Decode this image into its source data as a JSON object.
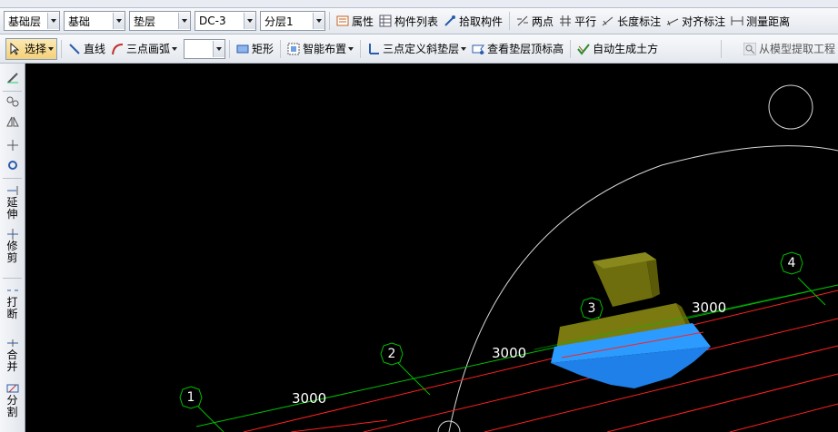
{
  "toolbar1": {
    "floor_combo": "基础层",
    "category_combo": "基础",
    "type_combo": "垫层",
    "component_combo": "DC-3",
    "layer_combo": "分层1",
    "properties_label": "属性",
    "component_list_label": "构件列表",
    "pick_component_label": "拾取构件",
    "two_point_label": "两点",
    "parallel_label": "平行",
    "length_dim_label": "长度标注",
    "aligned_dim_label": "对齐标注",
    "measure_distance_label": "测量距离"
  },
  "toolbar2": {
    "select_label": "选择",
    "line_label": "直线",
    "arc_label": "三点画弧",
    "rect_label": "矩形",
    "smart_layout_label": "智能布置",
    "slope_cushion_label": "三点定义斜垫层",
    "view_top_elev_label": "查看垫层顶标高",
    "auto_earthwork_label": "自动生成土方",
    "extract_from_model_label": "从模型提取工程"
  },
  "left_toolbar": {
    "extend_label": "延伸",
    "trim_label": "修剪",
    "break_label": "打断",
    "merge_label": "合并",
    "split_label": "分割"
  },
  "canvas": {
    "axis_labels": [
      "1",
      "2",
      "3",
      "4"
    ],
    "dimension_labels": [
      "3000",
      "3000",
      "3000"
    ],
    "colors": {
      "background": "#000000",
      "axis_line": "#00c000",
      "grid_line": "#ff2020",
      "cushion": "#1e8fff",
      "footing": "#8a8a10"
    }
  }
}
